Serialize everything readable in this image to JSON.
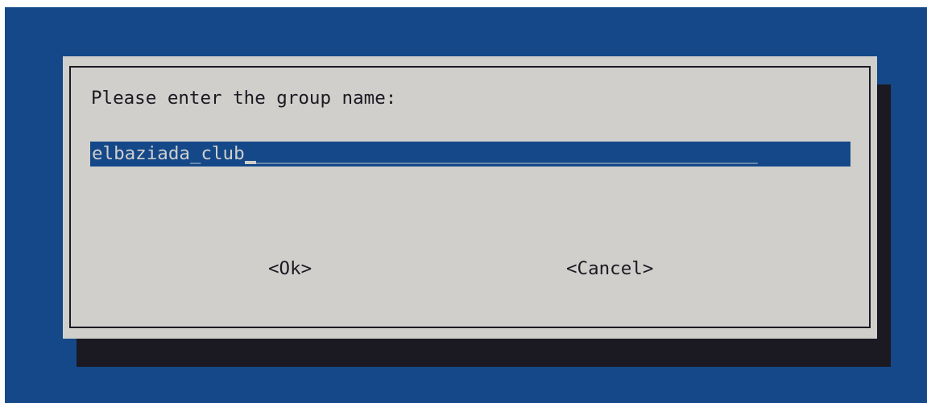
{
  "dialog": {
    "prompt": "Please enter the group name:",
    "input_value": "elbaziada_club",
    "input_fill": "______________________________________________",
    "ok_label": "<Ok>",
    "cancel_label": "<Cancel>"
  },
  "colors": {
    "background": "#144889",
    "dialog": "#d0cfcc",
    "shadow": "#1b1a22",
    "text": "#1b1a22",
    "input_bg": "#144889",
    "input_text": "#d0cfcc"
  }
}
